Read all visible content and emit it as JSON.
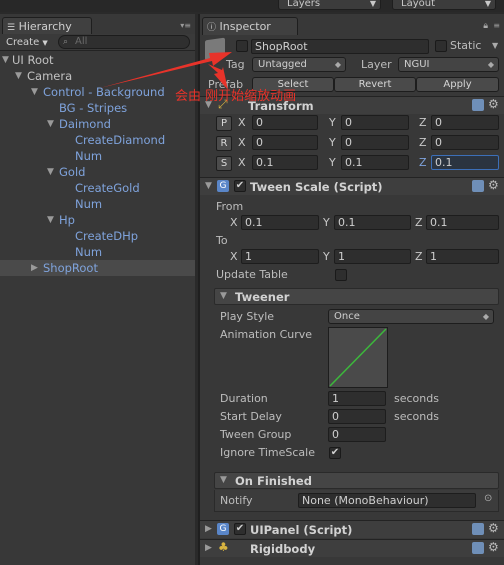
{
  "topbar": {
    "layers_label": "Layers",
    "layout_label": "Layout"
  },
  "hierarchy": {
    "tab_label": "Hierarchy",
    "create_label": "Create",
    "search_placeholder": "All",
    "rows": [
      {
        "label": "UI Root"
      },
      {
        "label": "Camera"
      },
      {
        "label": "Control - Background"
      },
      {
        "label": "BG - Stripes"
      },
      {
        "label": "Daimond"
      },
      {
        "label": "CreateDiamond"
      },
      {
        "label": "Num"
      },
      {
        "label": "Gold"
      },
      {
        "label": "CreateGold"
      },
      {
        "label": "Num"
      },
      {
        "label": "Hp"
      },
      {
        "label": "CreateDHp"
      },
      {
        "label": "Num"
      },
      {
        "label": "ShopRoot"
      }
    ]
  },
  "inspector": {
    "tab_label": "Inspector",
    "object_name": "ShopRoot",
    "static_label": "Static",
    "tag_label": "Tag",
    "tag_value": "Untagged",
    "layer_label": "Layer",
    "layer_value": "NGUI",
    "prefab_label": "Prefab",
    "prefab_buttons": {
      "select": "Select",
      "revert": "Revert",
      "apply": "Apply"
    },
    "transform": {
      "title": "Transform",
      "rows": [
        {
          "btn": "P",
          "x": "0",
          "y": "0",
          "z": "0"
        },
        {
          "btn": "R",
          "x": "0",
          "y": "0",
          "z": "0"
        },
        {
          "btn": "S",
          "x": "0.1",
          "y": "0.1",
          "z": "0.1"
        }
      ]
    },
    "tween_scale": {
      "title": "Tween Scale (Script)",
      "from_label": "From",
      "from": {
        "x": "0.1",
        "y": "0.1",
        "z": "0.1"
      },
      "to_label": "To",
      "to": {
        "x": "1",
        "y": "1",
        "z": "1"
      },
      "update_table_label": "Update Table",
      "tweener_title": "Tweener",
      "play_style_label": "Play Style",
      "play_style_value": "Once",
      "animation_curve_label": "Animation Curve",
      "duration_label": "Duration",
      "duration_value": "1",
      "start_delay_label": "Start Delay",
      "start_delay_value": "0",
      "tween_group_label": "Tween Group",
      "tween_group_value": "0",
      "ignore_timescale_label": "Ignore TimeScale",
      "seconds_label": "seconds",
      "on_finished_title": "On Finished",
      "notify_label": "Notify",
      "notify_value": "None (MonoBehaviour)"
    },
    "uipanel_title": "UIPanel (Script)",
    "rigidbody_title": "Rigidbody"
  },
  "axes": {
    "x": "X",
    "y": "Y",
    "z": "Z"
  },
  "annotation_text": "会由 刚开始缩放动画",
  "colors": {
    "accent_blue": "#7fa3dc",
    "annotation_red": "#e8332a",
    "curve_green": "#3cb83c"
  }
}
